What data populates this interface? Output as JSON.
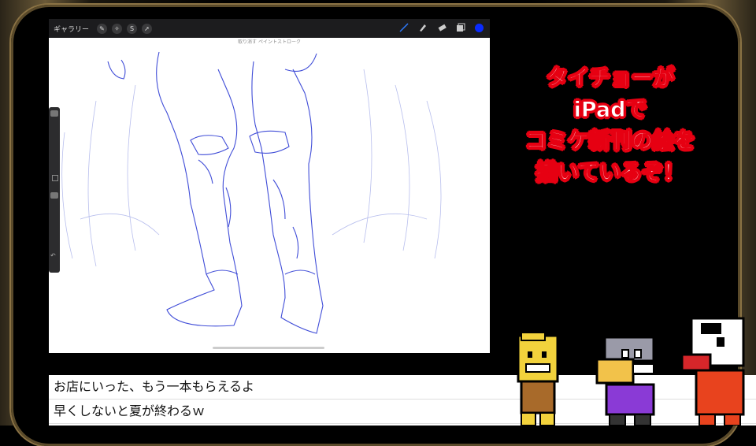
{
  "toolbar": {
    "gallery_label": "ギャラリー",
    "hint_text": "取り消す ペイントストローク",
    "color": "#0a2bff"
  },
  "icons": {
    "tools_left": [
      "wrench-icon",
      "wand-icon",
      "s-selection-icon",
      "arrow-icon"
    ],
    "tools_right": [
      "brush-icon",
      "smudge-icon",
      "eraser-icon",
      "layers-icon",
      "color-icon"
    ]
  },
  "caption": {
    "lines": [
      "タイチョーが",
      "iPadで",
      "コミケ新刊の絵を",
      "描いているぞ！"
    ],
    "outline_color": "#e60012"
  },
  "chat": {
    "lines": [
      "お店にいった、もう一本もらえるよ",
      "早くしないと夏が終わるｗ"
    ]
  }
}
